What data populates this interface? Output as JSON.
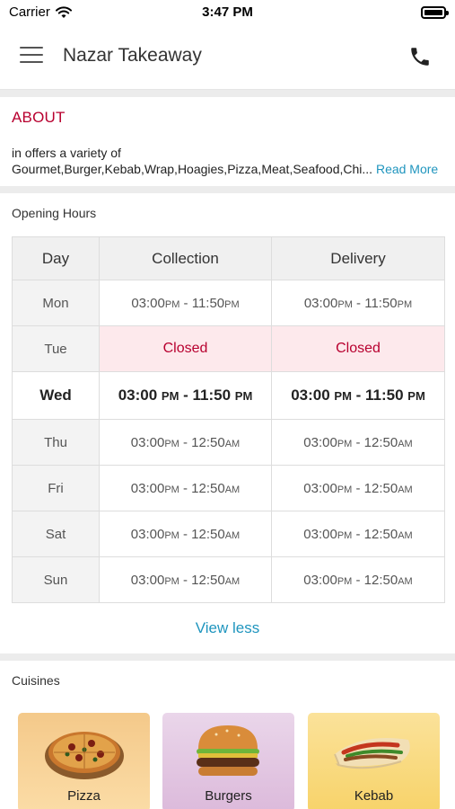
{
  "status_bar": {
    "carrier": "Carrier",
    "time": "3:47 PM"
  },
  "header": {
    "title": "Nazar Takeaway"
  },
  "about": {
    "heading": "ABOUT",
    "line1": "in  offers a variety of",
    "line2": "Gourmet,Burger,Kebab,Wrap,Hoagies,Pizza,Meat,Seafood,Chi...",
    "read_more": "Read More"
  },
  "hours": {
    "label": "Opening Hours",
    "columns": [
      "Day",
      "Collection",
      "Delivery"
    ],
    "rows": [
      {
        "day": "Mon",
        "collection_from": "03:00",
        "collection_from_ampm": "PM",
        "collection_to": "11:50",
        "collection_to_ampm": "PM",
        "delivery_from": "03:00",
        "delivery_from_ampm": "PM",
        "delivery_to": "11:50",
        "delivery_to_ampm": "PM"
      },
      {
        "day": "Tue",
        "collection_closed": "Closed",
        "delivery_closed": "Closed"
      },
      {
        "day": "Wed",
        "collection_from": "03:00",
        "collection_from_ampm": "PM",
        "collection_to": "11:50",
        "collection_to_ampm": "PM",
        "delivery_from": "03:00",
        "delivery_from_ampm": "PM",
        "delivery_to": "11:50",
        "delivery_to_ampm": "PM"
      },
      {
        "day": "Thu",
        "collection_from": "03:00",
        "collection_from_ampm": "PM",
        "collection_to": "12:50",
        "collection_to_ampm": "AM",
        "delivery_from": "03:00",
        "delivery_from_ampm": "PM",
        "delivery_to": "12:50",
        "delivery_to_ampm": "AM"
      },
      {
        "day": "Fri",
        "collection_from": "03:00",
        "collection_from_ampm": "PM",
        "collection_to": "12:50",
        "collection_to_ampm": "AM",
        "delivery_from": "03:00",
        "delivery_from_ampm": "PM",
        "delivery_to": "12:50",
        "delivery_to_ampm": "AM"
      },
      {
        "day": "Sat",
        "collection_from": "03:00",
        "collection_from_ampm": "PM",
        "collection_to": "12:50",
        "collection_to_ampm": "AM",
        "delivery_from": "03:00",
        "delivery_from_ampm": "PM",
        "delivery_to": "12:50",
        "delivery_to_ampm": "AM"
      },
      {
        "day": "Sun",
        "collection_from": "03:00",
        "collection_from_ampm": "PM",
        "collection_to": "12:50",
        "collection_to_ampm": "AM",
        "delivery_from": "03:00",
        "delivery_from_ampm": "PM",
        "delivery_to": "12:50",
        "delivery_to_ampm": "AM"
      }
    ],
    "view_less": "View less"
  },
  "cuisines": {
    "label": "Cuisines",
    "items": [
      {
        "name": "Pizza",
        "icon": "pizza-icon",
        "bg": "#f7cf8f"
      },
      {
        "name": "Burgers",
        "icon": "burger-icon",
        "bg": "#e3c7e3"
      },
      {
        "name": "Kebab",
        "icon": "kebab-icon",
        "bg": "#fbe08b"
      }
    ]
  },
  "colors": {
    "accent": "#b8002f",
    "link": "#1f95be",
    "closed_bg": "#fde9ec"
  }
}
